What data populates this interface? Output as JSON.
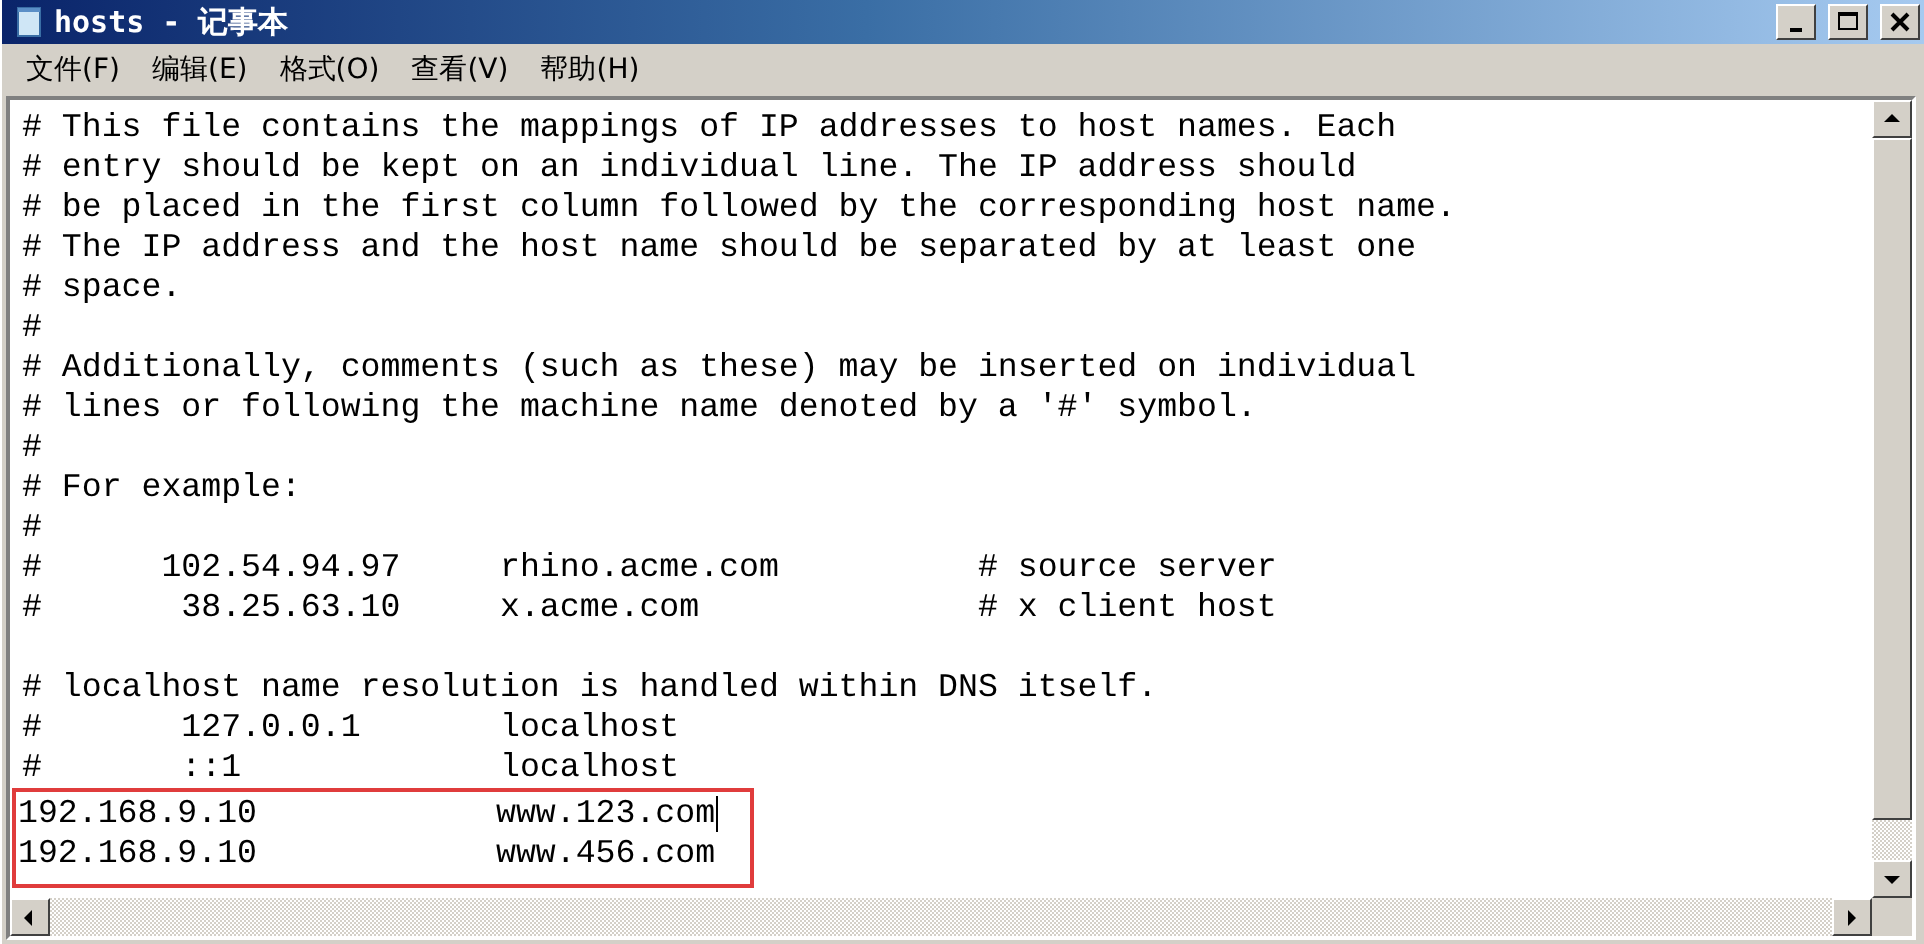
{
  "window": {
    "title": "hosts - 记事本"
  },
  "menu": [
    {
      "label": "文件(F)"
    },
    {
      "label": "编辑(E)"
    },
    {
      "label": "格式(O)"
    },
    {
      "label": "查看(V)"
    },
    {
      "label": "帮助(H)"
    }
  ],
  "lines": [
    {
      "kind": "text",
      "text": "# This file contains the mappings of IP addresses to host names. Each",
      "cursor": false
    },
    {
      "kind": "text",
      "text": "# entry should be kept on an individual line. The IP address should",
      "cursor": false
    },
    {
      "kind": "text",
      "text": "# be placed in the first column followed by the corresponding host name.",
      "cursor": false
    },
    {
      "kind": "text",
      "text": "# The IP address and the host name should be separated by at least one",
      "cursor": false
    },
    {
      "kind": "text",
      "text": "# space.",
      "cursor": false
    },
    {
      "kind": "text",
      "text": "#",
      "cursor": false
    },
    {
      "kind": "text",
      "text": "# Additionally, comments (such as these) may be inserted on individual",
      "cursor": false
    },
    {
      "kind": "text",
      "text": "# lines or following the machine name denoted by a '#' symbol.",
      "cursor": false
    },
    {
      "kind": "text",
      "text": "#",
      "cursor": false
    },
    {
      "kind": "text",
      "text": "# For example:",
      "cursor": false
    },
    {
      "kind": "text",
      "text": "#",
      "cursor": false
    },
    {
      "kind": "text",
      "text": "#      102.54.94.97     rhino.acme.com          # source server",
      "cursor": false
    },
    {
      "kind": "text",
      "text": "#       38.25.63.10     x.acme.com              # x client host",
      "cursor": false
    },
    {
      "kind": "blank",
      "cursor": false
    },
    {
      "kind": "text",
      "text": "# localhost name resolution is handled within DNS itself.",
      "cursor": false
    },
    {
      "kind": "text",
      "text": "#       127.0.0.1       localhost",
      "cursor": false
    },
    {
      "kind": "text",
      "text": "#       ::1             localhost",
      "cursor": false
    }
  ],
  "framed_lines": [
    {
      "kind": "text",
      "text": "192.168.9.10            www.123.com",
      "cursor": true
    },
    {
      "kind": "text",
      "text": "192.168.9.10            www.456.com",
      "cursor": false
    }
  ]
}
